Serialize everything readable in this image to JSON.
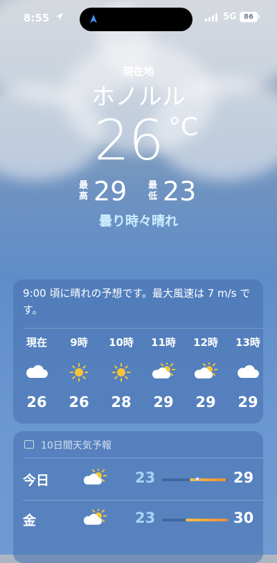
{
  "status_bar": {
    "time": "8:55",
    "network": "5G",
    "battery": "86"
  },
  "current": {
    "location_label": "現在地",
    "city": "ホノルル",
    "temperature": "26",
    "unit": "°C",
    "high_label": "最高",
    "high": "29",
    "low_label": "最低",
    "low": "23",
    "condition": "曇り時々晴れ"
  },
  "hourly": {
    "summary": "9:00 頃に晴れの予想です。最大風速は 7 m/s です。",
    "hours": [
      {
        "label": "現在",
        "icon": "cloud-icon",
        "temp": "26"
      },
      {
        "label": "9時",
        "icon": "sun-icon",
        "temp": "26"
      },
      {
        "label": "10時",
        "icon": "sun-icon",
        "temp": "28"
      },
      {
        "label": "11時",
        "icon": "partly-cloudy-icon",
        "temp": "29"
      },
      {
        "label": "12時",
        "icon": "partly-cloudy-icon",
        "temp": "29"
      },
      {
        "label": "13時",
        "icon": "cloud-icon",
        "temp": "29"
      }
    ]
  },
  "ten_day": {
    "title": "10日間天気予報",
    "days": [
      {
        "day": "今日",
        "icon": "partly-cloudy-icon",
        "low": "23",
        "high": "29",
        "bar_start": 0.42,
        "bar_end": 0.98,
        "current": 0.54
      },
      {
        "day": "金",
        "icon": "partly-cloudy-icon",
        "low": "23",
        "high": "30",
        "bar_start": 0.36,
        "bar_end": 1.0
      }
    ]
  },
  "colors": {
    "condition_text": "#cdeeff",
    "low_temp": "#a9d3f3",
    "sun": "#f6c43a"
  }
}
